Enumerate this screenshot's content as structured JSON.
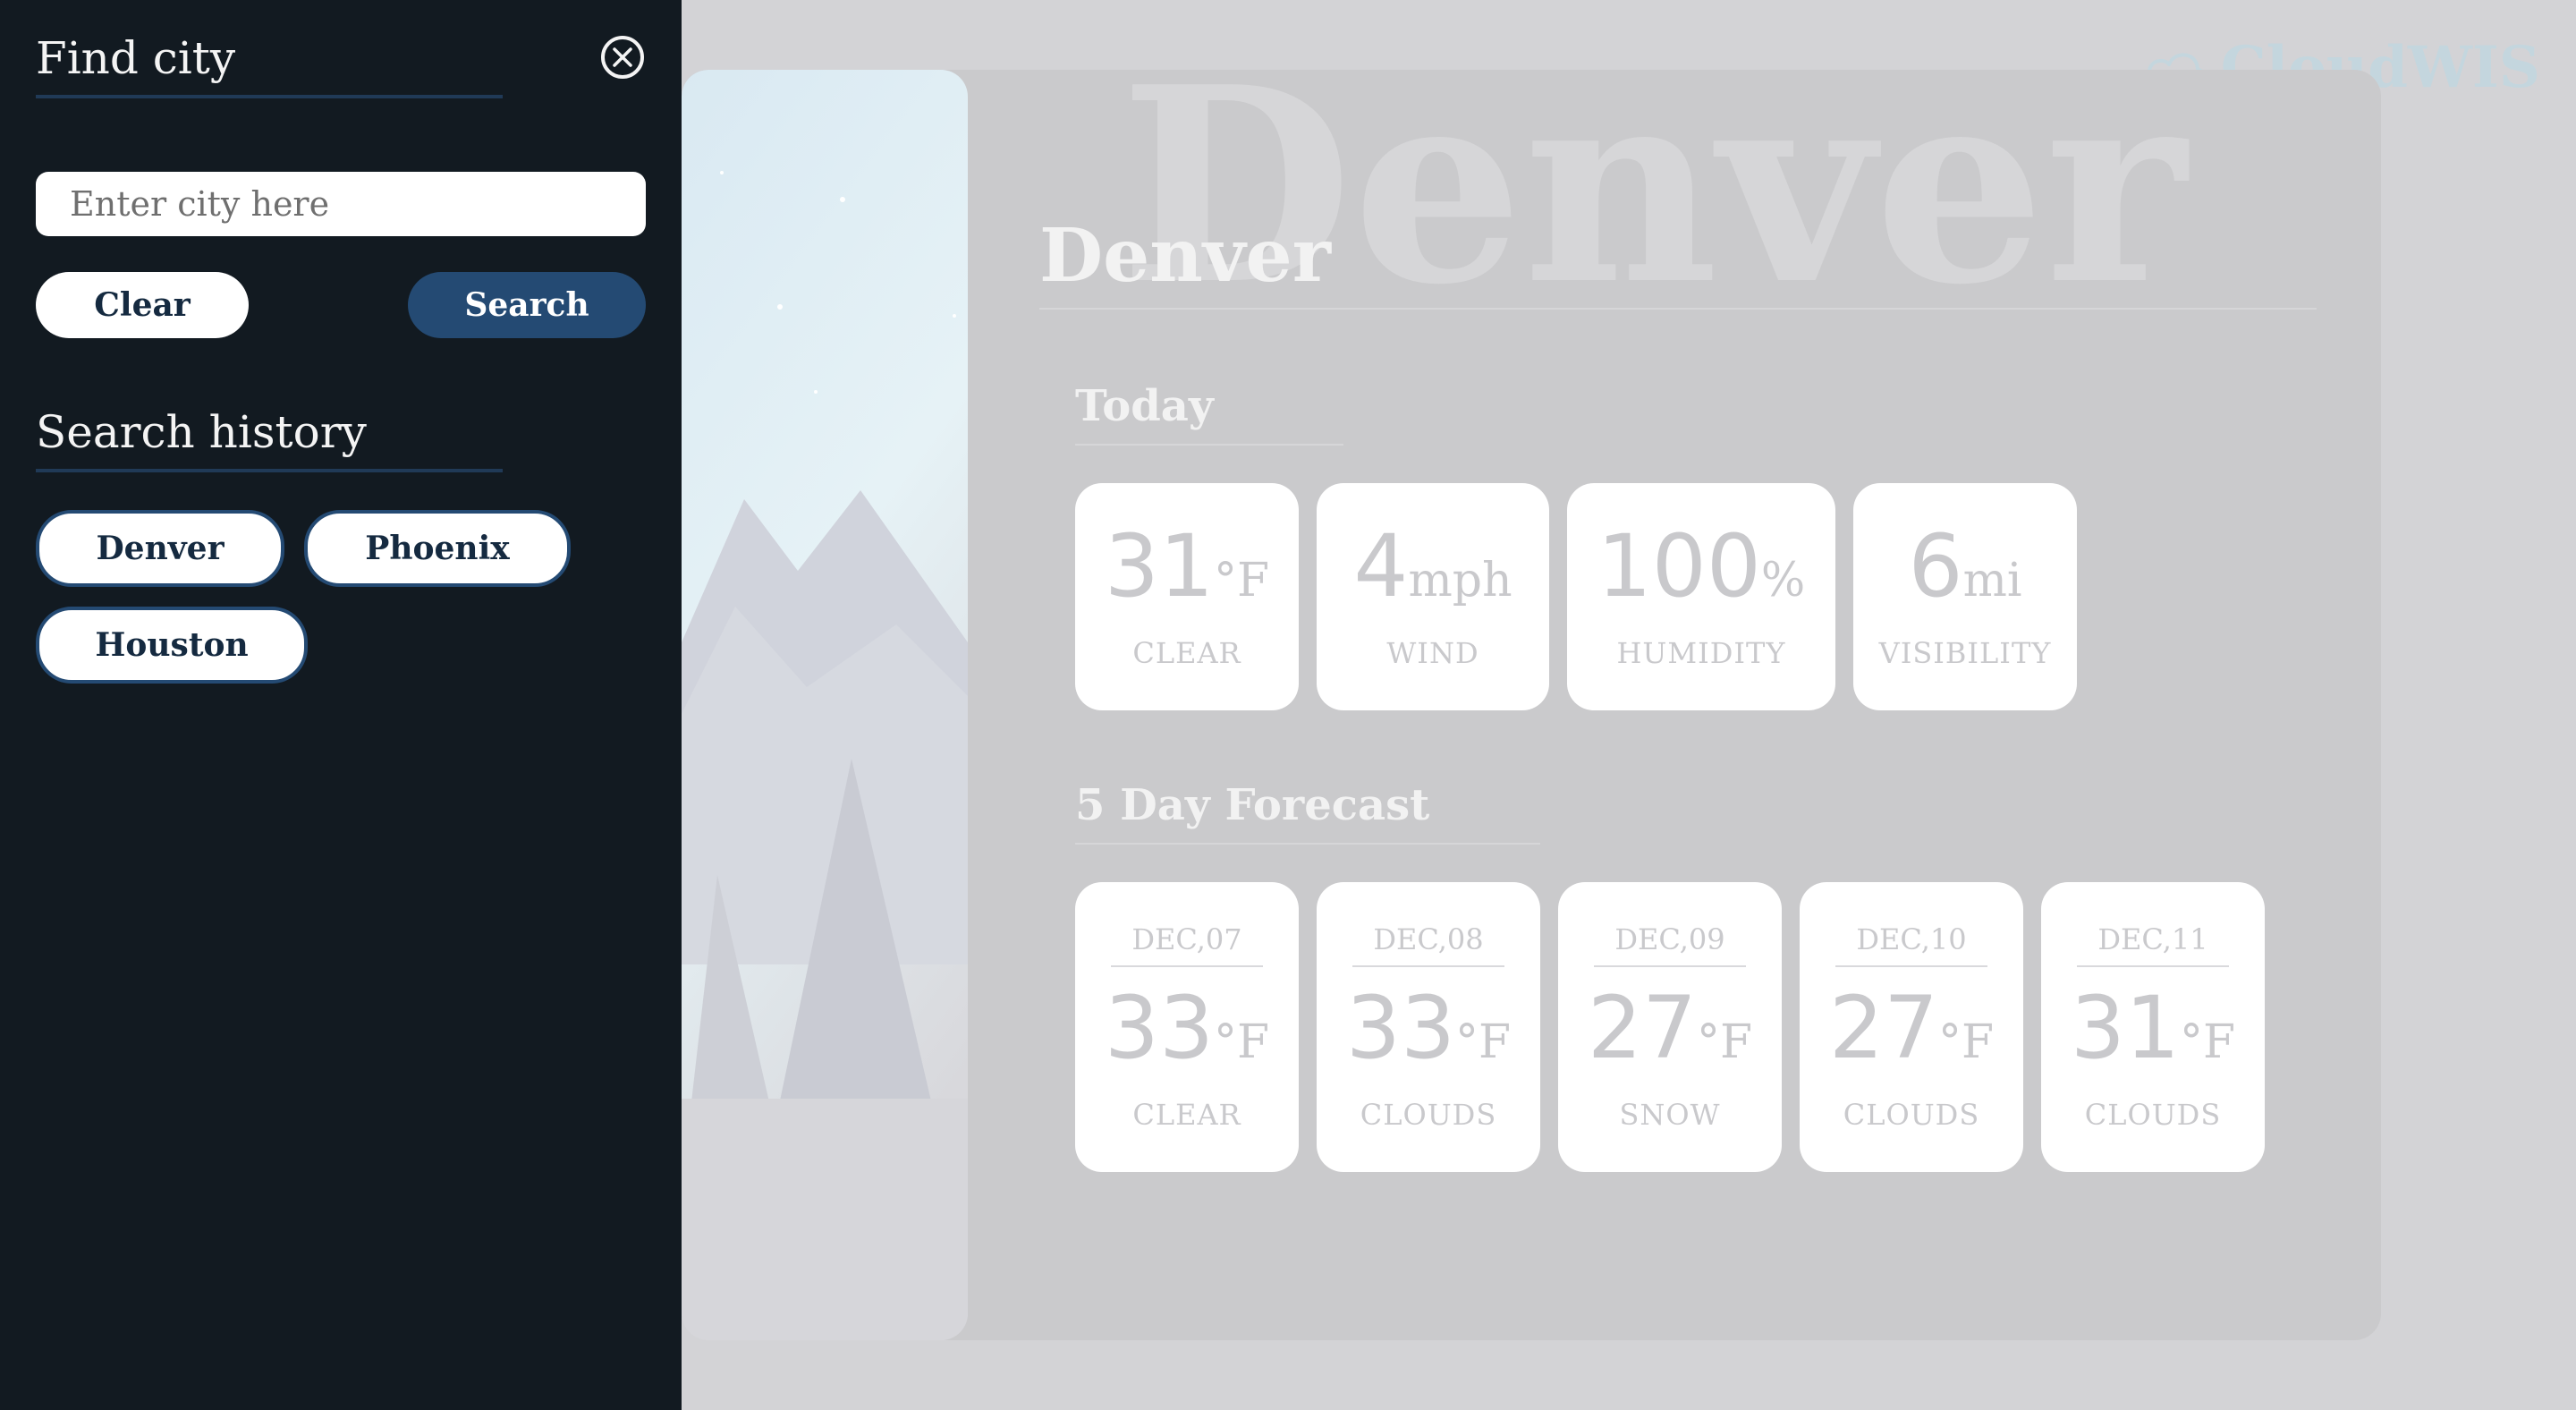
{
  "brand": {
    "name": "CloudWIS",
    "icon": "cloud-icon"
  },
  "city": {
    "name": "Denver",
    "ghost": "Denver"
  },
  "today": {
    "title": "Today",
    "tiles": [
      {
        "value": "31",
        "unit": "°F",
        "label": "CLEAR"
      },
      {
        "value": "4",
        "unit": "mph",
        "label": "WIND"
      },
      {
        "value": "100",
        "unit": "%",
        "label": "HUMIDITY"
      },
      {
        "value": "6",
        "unit": "mi",
        "label": "VISIBILITY"
      }
    ]
  },
  "forecast": {
    "title": "5 Day Forecast",
    "days": [
      {
        "date": "DEC,07",
        "temp": "33",
        "unit": "°F",
        "cond": "CLEAR"
      },
      {
        "date": "DEC,08",
        "temp": "33",
        "unit": "°F",
        "cond": "CLOUDS"
      },
      {
        "date": "DEC,09",
        "temp": "27",
        "unit": "°F",
        "cond": "SNOW"
      },
      {
        "date": "DEC,10",
        "temp": "27",
        "unit": "°F",
        "cond": "CLOUDS"
      },
      {
        "date": "DEC,11",
        "temp": "31",
        "unit": "°F",
        "cond": "CLOUDS"
      }
    ]
  },
  "panel": {
    "find_title": "Find city",
    "close_icon": "close-icon",
    "search_placeholder": "Enter city here",
    "search_value": "",
    "clear_label": "Clear",
    "search_label": "Search",
    "history_title": "Search history",
    "history": [
      "Denver",
      "Phoenix",
      "Houston"
    ]
  },
  "colors": {
    "panel_bg": "#121a21",
    "accent": "#244a73",
    "page_bg": "#d3d3d6"
  }
}
